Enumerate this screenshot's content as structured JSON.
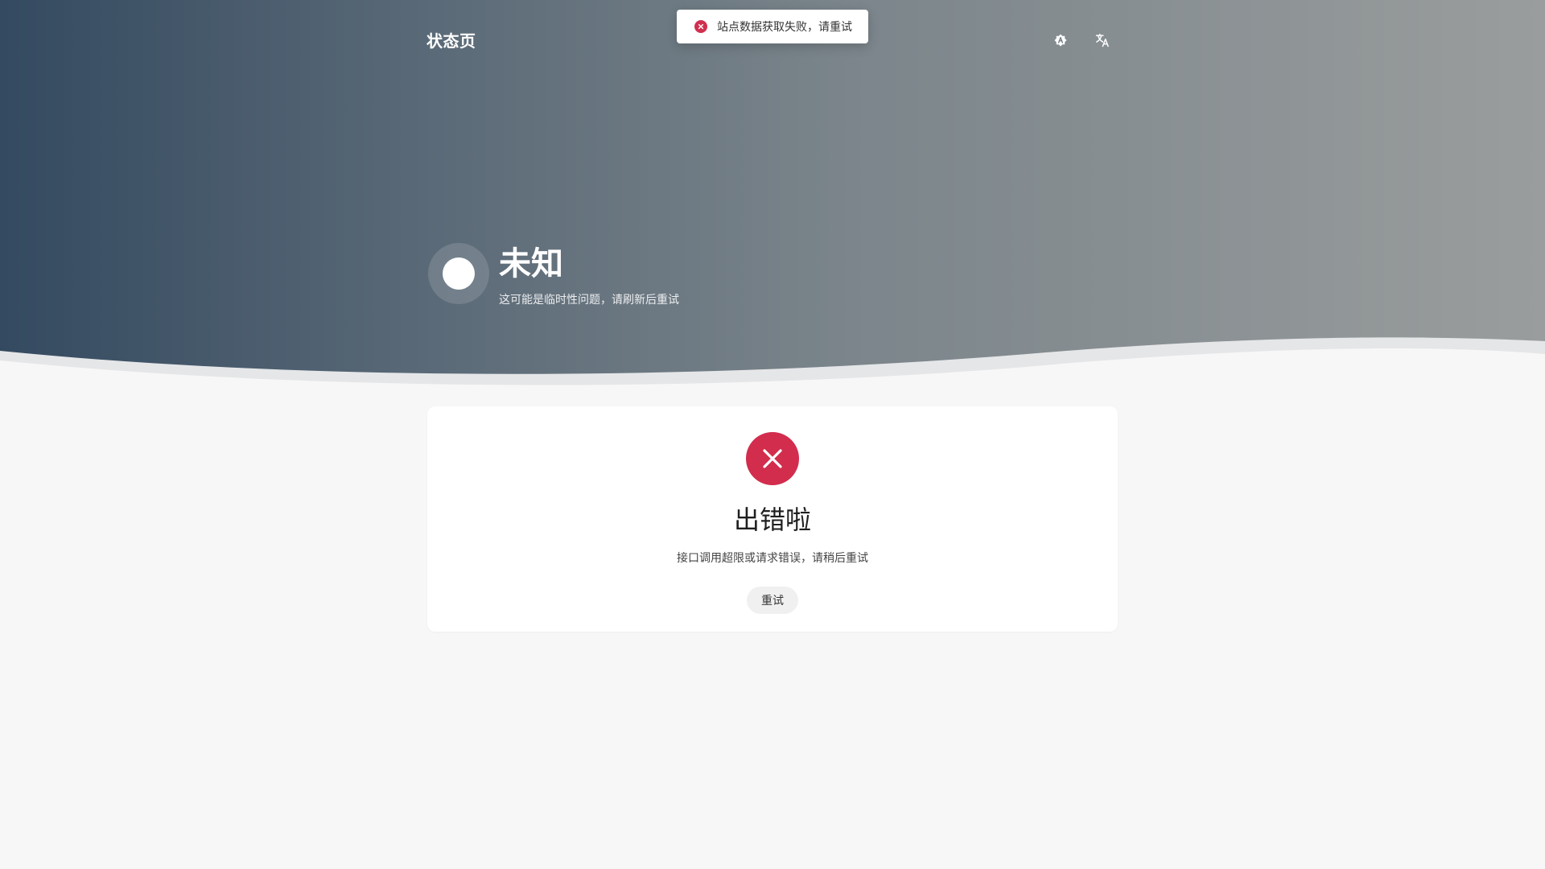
{
  "header": {
    "site_title": "状态页",
    "theme_icon": "theme-toggle-icon",
    "language_icon": "translate-icon"
  },
  "toast": {
    "icon": "error-circle-icon",
    "message": "站点数据获取失败，请重试"
  },
  "status": {
    "title": "未知",
    "description": "这可能是临时性问题，请刷新后重试"
  },
  "error_card": {
    "icon": "close-icon",
    "title": "出错啦",
    "description": "接口调用超限或请求错误，请稍后重试",
    "retry_label": "重试"
  },
  "colors": {
    "error": "#d22d4d",
    "hero_start": "#344a60",
    "hero_end": "#9a9d9d",
    "page_background": "#f7f7f7"
  }
}
